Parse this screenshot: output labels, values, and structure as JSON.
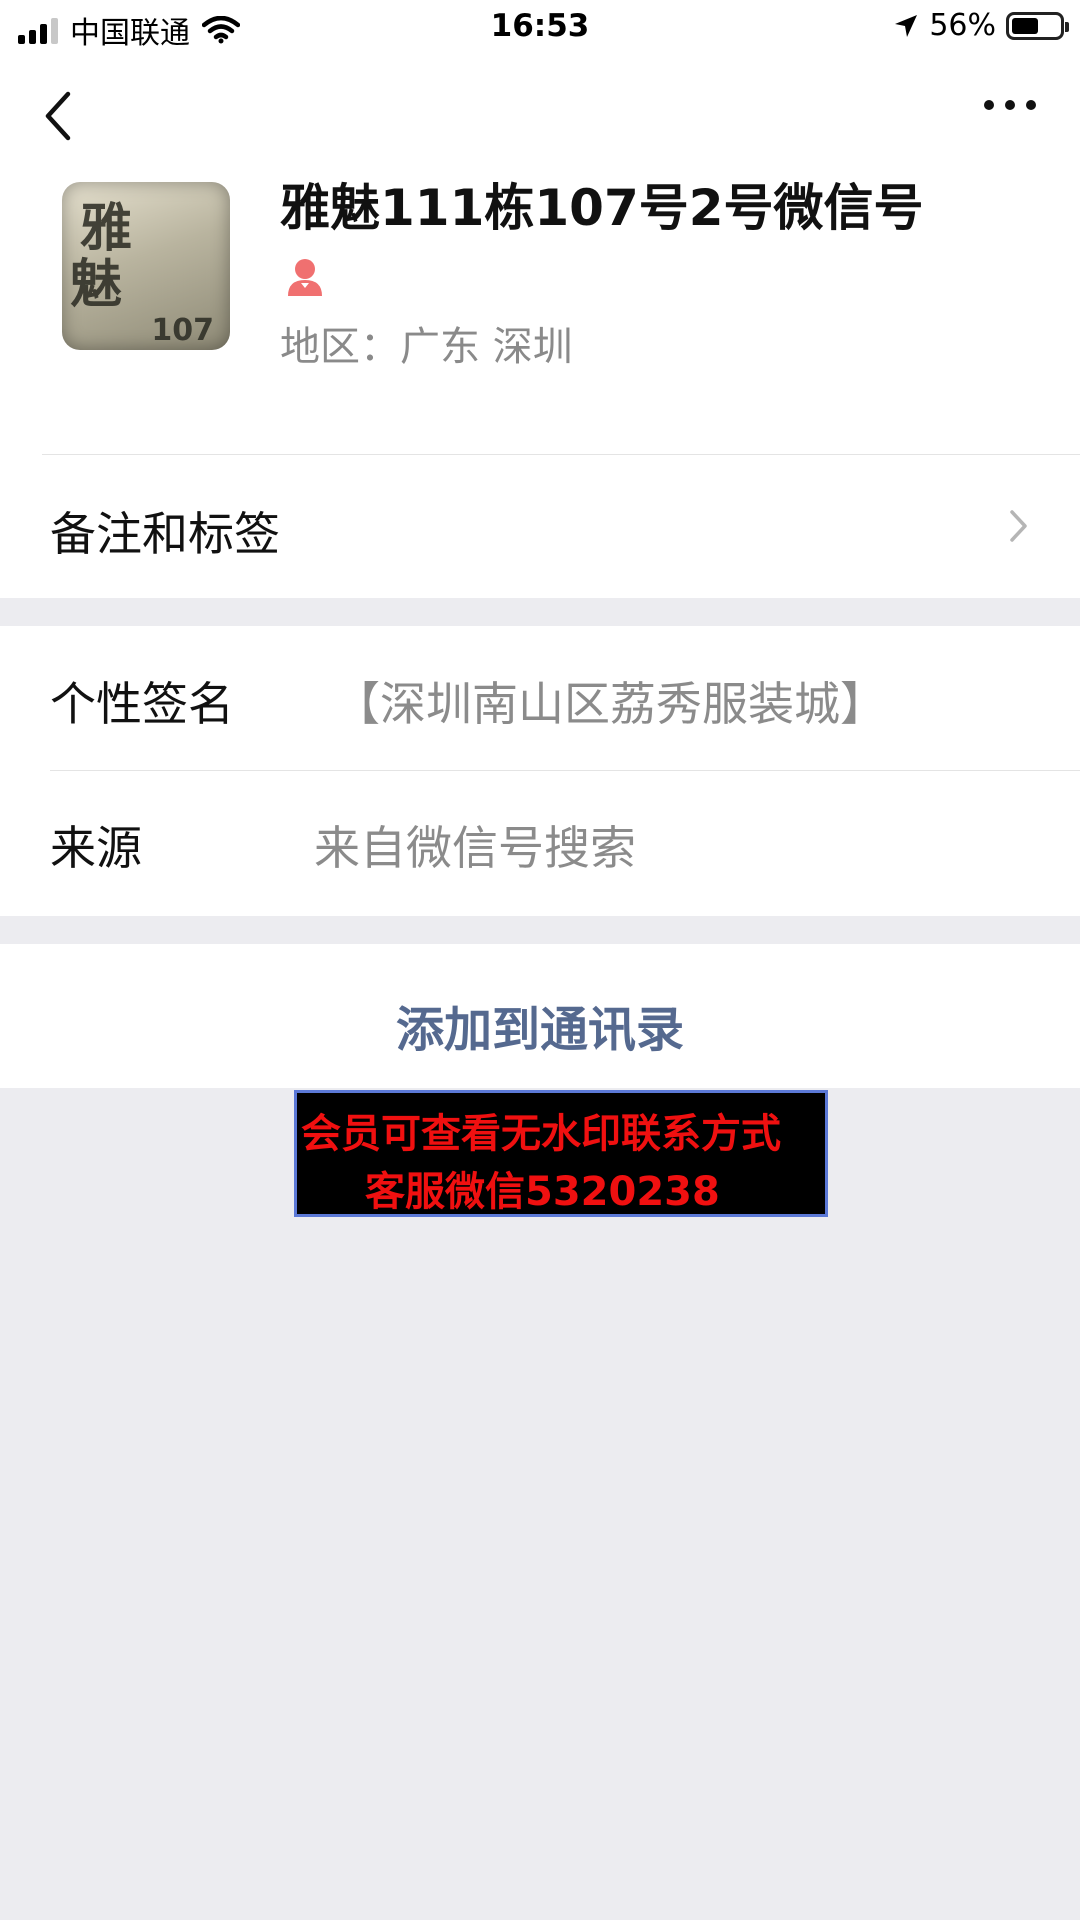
{
  "status_bar": {
    "carrier": "中国联通",
    "time": "16:53",
    "battery_percent": "56%",
    "battery_level": 0.56,
    "icons": [
      "signal-icon",
      "wifi-icon",
      "location-arrow-icon",
      "battery-icon"
    ]
  },
  "nav": {
    "back_icon": "chevron-left-icon",
    "more_icon": "more-dots-icon"
  },
  "profile": {
    "name": "雅魅111栋107号2号微信号",
    "gender_icon": "female-icon",
    "gender_color": "#f07070",
    "region": "地区：广东 深圳",
    "avatar_text": {
      "char1": "雅",
      "char2": "魅",
      "number": "107"
    }
  },
  "rows": {
    "remarks_tags": "备注和标签",
    "signature_label": "个性签名",
    "signature_value": "【深圳南山区荔秀服装城】",
    "source_label": "来源",
    "source_value": "来自微信号搜索"
  },
  "actions": {
    "add_to_contacts": "添加到通讯录",
    "link_color": "#55698f"
  },
  "watermark": {
    "line1": "会员可查看无水印联系方式",
    "line2": "客服微信5320238",
    "text_color": "#f01010"
  }
}
